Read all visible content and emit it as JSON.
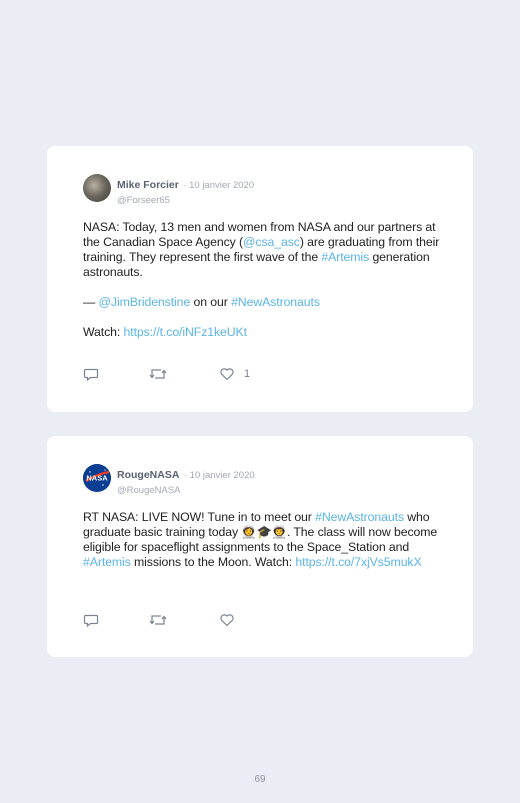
{
  "tweets": [
    {
      "name": "Mike Forcier",
      "date": "· 10 janvier 2020",
      "handle": "@Forseer65",
      "body": {
        "p1_a": "NASA: Today, 13 men and women from NASA and our partners at the Canadian Space Agency (",
        "p1_link1": "@csa_asc",
        "p1_b": ") are graduating from their training. They represent the first wave of the ",
        "p1_link2": "#Artemis",
        "p1_c": " generation astronauts.",
        "p2_a": "— ",
        "p2_link1": "@JimBridenstine",
        "p2_b": " on our ",
        "p2_link2": "#NewAstronauts",
        "p3_a": "Watch: ",
        "p3_link": "https://t.co/iNFz1keUKt"
      },
      "likes": "1"
    },
    {
      "name": "RougeNASA",
      "date": "· 10 janvier 2020",
      "handle": "@RougeNASA",
      "avatar_text": "NASA",
      "body": {
        "a": "RT NASA: LIVE NOW! Tune in to meet our ",
        "link1": "#NewAstronauts",
        "b": " who graduate basic training today 👩‍🚀🎓👨‍🚀. The class will now become eligible for spaceflight assignments to the Space_Station and ",
        "link2": "#Artemis",
        "c": " missions to the Moon. Watch: ",
        "link3": "https://t.co/7xjVs5mukX"
      },
      "likes": ""
    }
  ],
  "page_number": "69"
}
